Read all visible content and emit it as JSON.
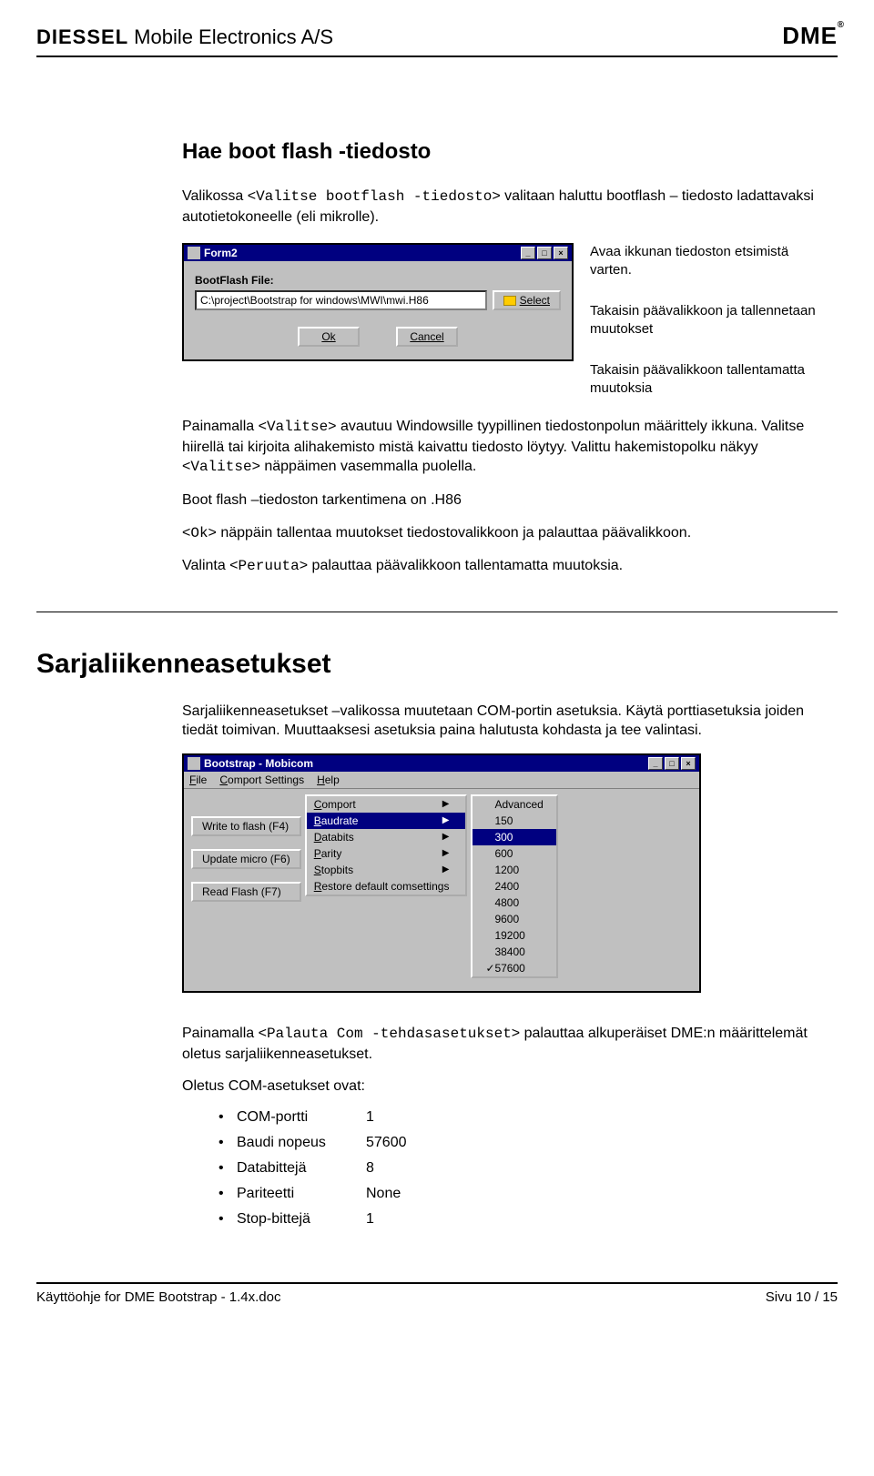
{
  "header": {
    "brand_left": "DIESSEL",
    "brand_mid": "Mobile Electronics A/S",
    "brand_right": "DME"
  },
  "sec1": {
    "title": "Hae boot flash -tiedosto",
    "intro_a": "Valikossa <",
    "intro_code": "Valitse bootflash -tiedosto",
    "intro_b": "> valitaan haluttu bootflash – tiedosto ladattavaksi autotietokoneelle (eli mikrolle).",
    "callout1": "Avaa ikkunan tiedoston etsimistä varten.",
    "callout2": "Takaisin päävalikkoon ja tallennetaan muutokset",
    "callout3": "Takaisin päävalikkoon tallentamatta muutoksia"
  },
  "dialog1": {
    "title": "Form2",
    "label": "BootFlash File:",
    "path": "C:\\project\\Bootstrap for windows\\MWI\\mwi.H86",
    "select": "Select",
    "ok": "Ok",
    "cancel": "Cancel"
  },
  "body1": {
    "p1_a": "Painamalla <",
    "p1_code": "Valitse",
    "p1_b": "> avautuu Windowsille tyypillinen tiedostonpolun määrittely ikkuna. Valitse hiirellä tai kirjoita alihakemisto mistä kaivattu tiedosto löytyy. Valittu hakemistopolku näkyy <",
    "p1_code2": "Valitse",
    "p1_c": "> näppäimen vasemmalla puolella.",
    "p2": "Boot flash –tiedoston tarkentimena on .H86",
    "p3_a": "<",
    "p3_code": "Ok",
    "p3_b": "> näppäin tallentaa muutokset tiedostovalikkoon ja palauttaa päävalikkoon.",
    "p4_a": "Valinta <",
    "p4_code": "Peruuta",
    "p4_b": "> palauttaa päävalikkoon tallentamatta muutoksia."
  },
  "sec2": {
    "title": "Sarjaliikenneasetukset",
    "intro": "Sarjaliikenneasetukset –valikossa muutetaan COM-portin asetuksia. Käytä porttiasetuksia joiden tiedät toimivan. Muuttaaksesi asetuksia paina halutusta kohdasta ja tee valintasi."
  },
  "dialog2": {
    "title": "Bootstrap - Mobicom",
    "menubar": {
      "file": "File",
      "comport": "Comport Settings",
      "help": "Help"
    },
    "left_buttons": {
      "write": "Write to flash (F4)",
      "update": "Update micro (F6)",
      "read": "Read Flash (F7)"
    },
    "dropdown": {
      "comport": "Comport",
      "baudrate": "Baudrate",
      "databits": "Databits",
      "parity": "Parity",
      "stopbits": "Stopbits",
      "restore": "Restore default comsettings",
      "advanced": "Advanced"
    },
    "baud_options": [
      "150",
      "300",
      "600",
      "1200",
      "2400",
      "4800",
      "9600",
      "19200",
      "38400",
      "57600"
    ],
    "baud_selected": "300",
    "baud_checked": "57600"
  },
  "body2": {
    "p1_a": "Painamalla <",
    "p1_code": "Palauta Com -tehdasasetukset",
    "p1_b": "> palauttaa alkuperäiset DME:n määrittelemät oletus sarjaliikenneasetukset.",
    "p2": "Oletus COM-asetukset ovat:",
    "defaults": [
      {
        "k": "COM-portti",
        "v": "1"
      },
      {
        "k": "Baudi nopeus",
        "v": "57600"
      },
      {
        "k": "Databittejä",
        "v": "8"
      },
      {
        "k": "Pariteetti",
        "v": "None"
      },
      {
        "k": "Stop-bittejä",
        "v": "1"
      }
    ]
  },
  "footer": {
    "doc": "Käyttöohje for DME Bootstrap - 1.4x.doc",
    "page": "Sivu 10 / 15"
  }
}
